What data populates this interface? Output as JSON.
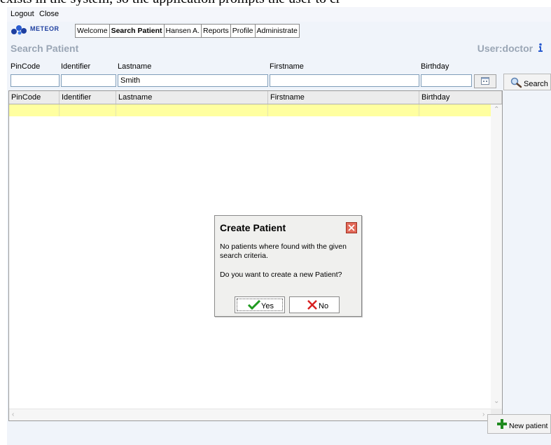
{
  "document_text": "exists in the system, so the application prompts the user to cr",
  "menubar": {
    "logout": "Logout",
    "close": "Close"
  },
  "logo": {
    "text": "METEOR"
  },
  "tabs": [
    {
      "label": "Welcome",
      "active": false
    },
    {
      "label": "Search Patient",
      "active": true
    },
    {
      "label": "Hansen A.",
      "active": false
    },
    {
      "label": "Reports",
      "active": false
    },
    {
      "label": "Profile",
      "active": false
    },
    {
      "label": "Administrate",
      "active": false
    }
  ],
  "page": {
    "title": "Search Patient",
    "user": "User:doctor"
  },
  "form": {
    "labels": {
      "pincode": "PinCode",
      "identifier": "Identifier",
      "lastname": "Lastname",
      "firstname": "Firstname",
      "birthday": "Birthday"
    },
    "values": {
      "pincode": "",
      "identifier": "",
      "lastname": "Smith",
      "firstname": "",
      "birthday": ""
    },
    "search_label": "Search"
  },
  "grid": {
    "columns": [
      "PinCode",
      "Identifier",
      "Lastname",
      "Firstname",
      "Birthday"
    ],
    "rows": []
  },
  "new_patient_label": "New patient",
  "dialog": {
    "title": "Create Patient",
    "message": "No patients where found with the given search criteria.",
    "question": "Do you want to create a new Patient?",
    "yes_label": "Yes",
    "no_label": "No"
  },
  "colors": {
    "accent": "#1e3fa0",
    "row_highlight": "#ffffa0",
    "title_gray": "#9aa6b5",
    "dialog_close": "#e26a5a"
  }
}
